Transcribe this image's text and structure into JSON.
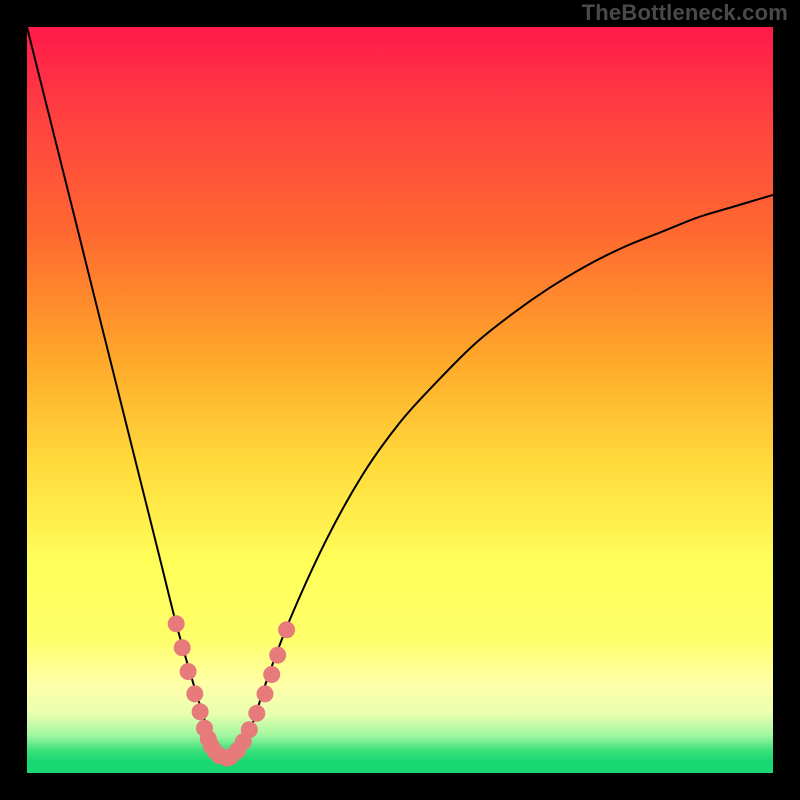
{
  "watermark": "TheBottleneck.com",
  "colors": {
    "curve_stroke": "#000000",
    "marker_fill": "#e77a7a",
    "marker_stroke": "#c55a5a"
  },
  "chart_data": {
    "type": "line",
    "title": "",
    "xlabel": "",
    "ylabel": "",
    "xlim": [
      0,
      100
    ],
    "ylim": [
      0,
      100
    ],
    "grid": false,
    "legend": false,
    "series": [
      {
        "name": "bottleneck-curve",
        "x": [
          0,
          3,
          6,
          9,
          12,
          15,
          18,
          20,
          22,
          24,
          25,
          26,
          27,
          28,
          30,
          32,
          35,
          40,
          45,
          50,
          55,
          60,
          65,
          70,
          75,
          80,
          85,
          90,
          95,
          100
        ],
        "y": [
          100,
          88,
          76,
          64,
          52,
          40,
          28,
          20,
          13,
          6.5,
          3.5,
          2,
          2,
          2.5,
          6,
          12,
          20,
          31,
          40,
          47,
          52.5,
          57.5,
          61.5,
          65,
          68,
          70.5,
          72.5,
          74.5,
          76,
          77.5
        ]
      }
    ],
    "markers": {
      "name": "highlighted-points",
      "x": [
        20.0,
        20.8,
        21.6,
        22.5,
        23.2,
        23.8,
        24.3,
        24.7,
        25.2,
        25.8,
        26.8,
        27.3,
        28.2,
        29.0,
        29.8,
        30.8,
        31.9,
        32.8,
        33.6,
        34.8
      ],
      "y": [
        20.0,
        16.8,
        13.6,
        10.6,
        8.2,
        6.0,
        4.6,
        3.6,
        2.9,
        2.3,
        2.0,
        2.2,
        3.0,
        4.2,
        5.8,
        8.0,
        10.6,
        13.2,
        15.8,
        19.2
      ]
    }
  }
}
